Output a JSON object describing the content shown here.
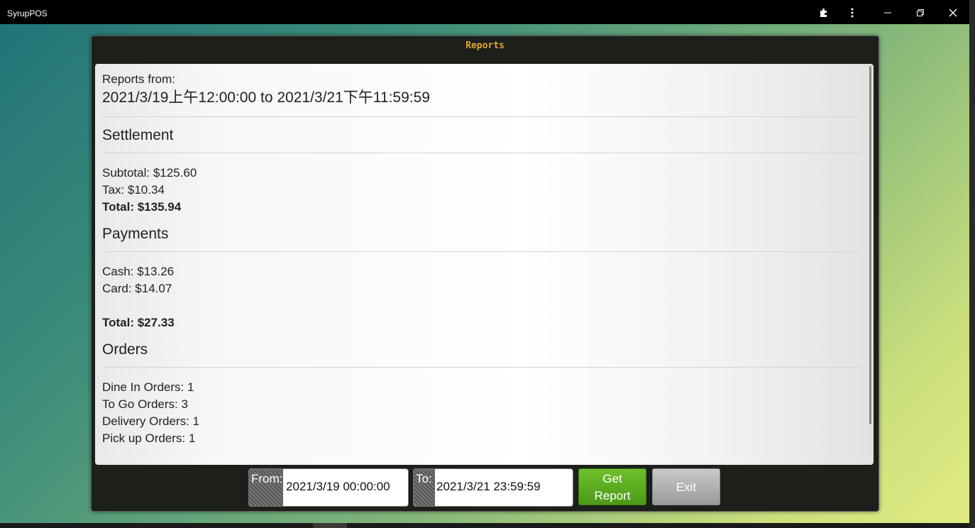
{
  "window": {
    "app_title": "SyrupPOS",
    "icons": [
      "puzzle-icon",
      "more-vertical-icon",
      "minimize-icon",
      "restore-icon",
      "close-icon"
    ]
  },
  "dialog": {
    "title": "Reports",
    "reports_from_label": "Reports from:",
    "date_range": "2021/3/19上午12:00:00 to 2021/3/21下午11:59:59",
    "settlement": {
      "heading": "Settlement",
      "subtotal": "Subtotal: $125.60",
      "tax": "Tax: $10.34",
      "total": "Total: $135.94"
    },
    "payments": {
      "heading": "Payments",
      "cash": "Cash: $13.26",
      "card": "Card: $14.07",
      "total": "Total: $27.33"
    },
    "orders": {
      "heading": "Orders",
      "dine_in": "Dine In Orders: 1",
      "to_go": "To Go Orders: 3",
      "delivery": "Delivery Orders: 1",
      "pick_up": "Pick up Orders: 1"
    }
  },
  "controls": {
    "from_label": "From:",
    "from_value": "2021/3/19 00:00:00",
    "to_label": "To:",
    "to_value": "2021/3/21 23:59:59",
    "get_report_line1": "Get",
    "get_report_line2": "Report",
    "exit_label": "Exit"
  },
  "colors": {
    "title_accent": "#e6a52a",
    "get_report_button": "#5aab1f",
    "exit_button": "#aaaaaa"
  }
}
